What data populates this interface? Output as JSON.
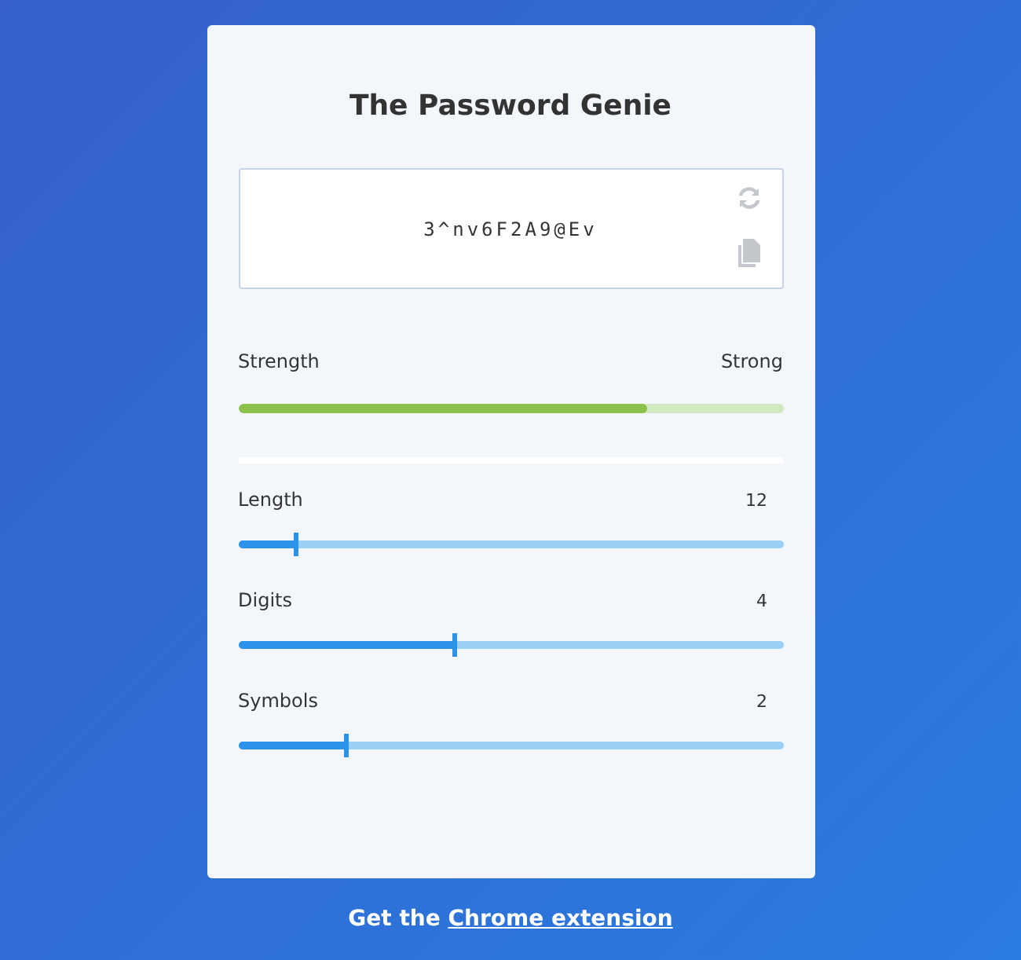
{
  "title": "The Password Genie",
  "password": {
    "value": "3^nv6F2A9@Ev"
  },
  "strength": {
    "label": "Strength",
    "rating": "Strong",
    "level": 0.75
  },
  "sliders": [
    {
      "label": "Length",
      "value": "12",
      "level": 0.107
    },
    {
      "label": "Digits",
      "value": "4",
      "level": 0.4
    },
    {
      "label": "Symbols",
      "value": "2",
      "level": 0.2
    }
  ],
  "footer": {
    "text": "Get the",
    "link": "Chrome extension"
  }
}
